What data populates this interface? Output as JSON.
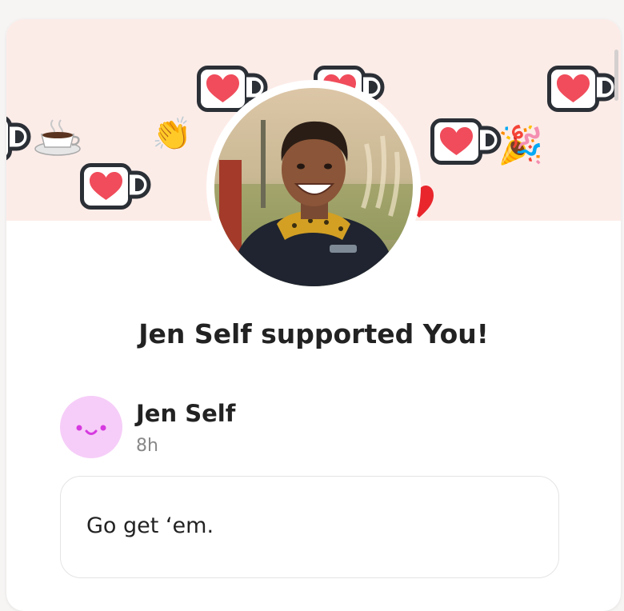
{
  "headline": "Jen Self supported You!",
  "supporter": {
    "name": "Jen Self",
    "time": "8h",
    "message": "Go get ‘em."
  },
  "banner": {
    "decorations": [
      "mug-heart-icon",
      "clapping-hands-icon",
      "coffee-cup-icon",
      "party-popper-icon",
      "heart-icon"
    ]
  },
  "colors": {
    "banner_bg": "#fcece8",
    "heart": "#f04c5b",
    "mug_outline": "#2b2f36",
    "author_avatar_bg": "#f6cdf8",
    "face": "#d63ae0"
  }
}
